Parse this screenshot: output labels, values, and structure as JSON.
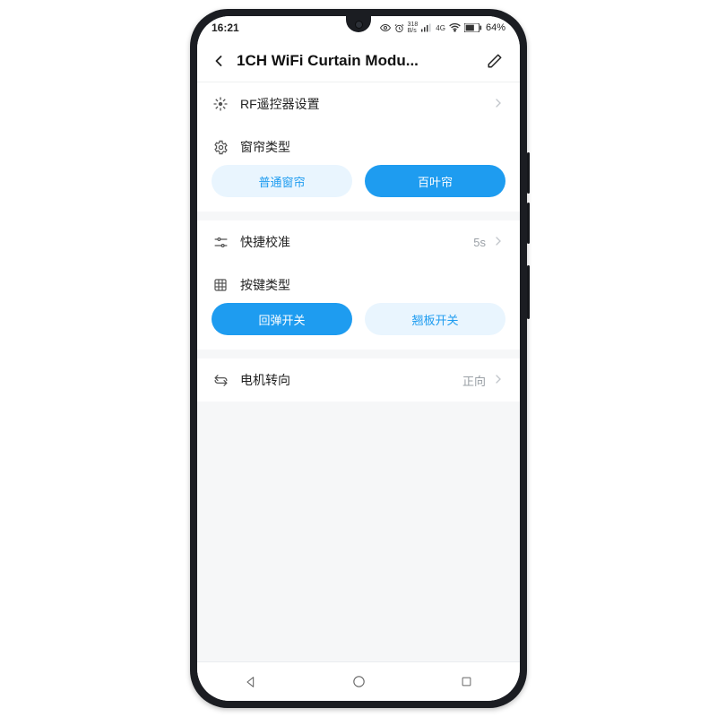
{
  "status": {
    "time": "16:21",
    "speed": "318",
    "speed_unit": "B/s",
    "net": "4G",
    "battery": "64%"
  },
  "header": {
    "title": "1CH WiFi Curtain Modu..."
  },
  "sections": {
    "rf": {
      "label": "RF遥控器设置"
    },
    "curtain_type": {
      "label": "窗帘类型",
      "options": {
        "normal": "普通窗帘",
        "blinds": "百叶帘"
      }
    },
    "quick_cal": {
      "label": "快捷校准",
      "value": "5s"
    },
    "key_type": {
      "label": "按键类型",
      "options": {
        "rebound": "回弹开关",
        "rocker": "翘板开关"
      }
    },
    "motor": {
      "label": "电机转向",
      "value": "正向"
    }
  }
}
